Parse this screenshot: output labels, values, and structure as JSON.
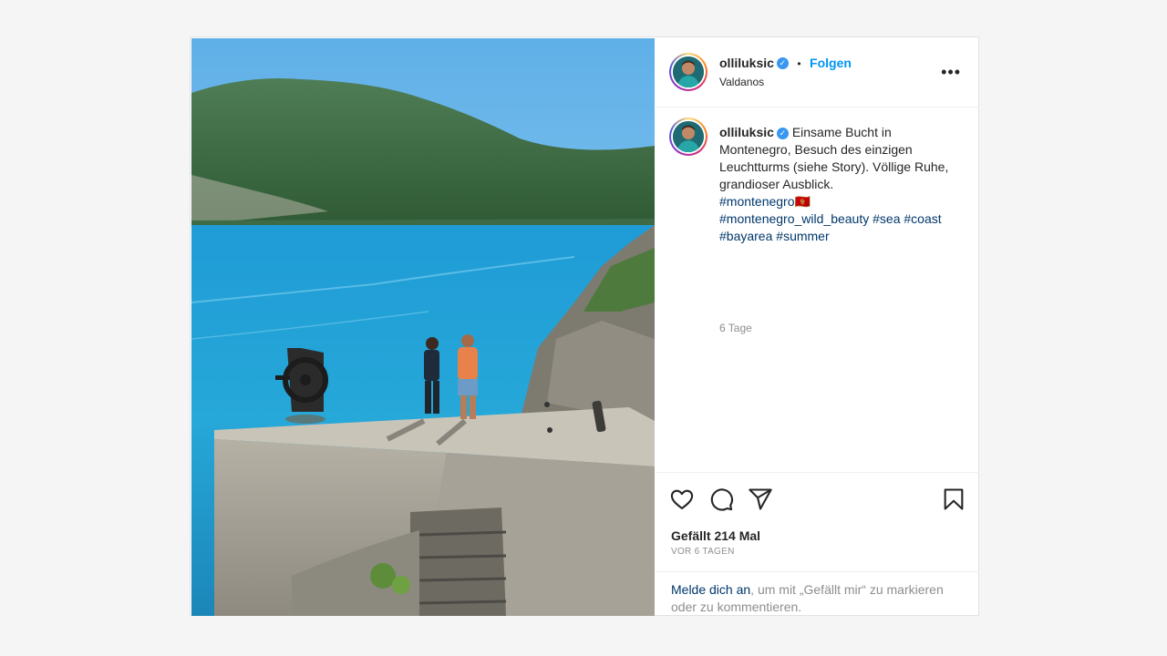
{
  "post": {
    "username": "olliluksic",
    "verified_badge": "verified-check-icon",
    "separator": "•",
    "follow_label": "Folgen",
    "location": "Valdanos",
    "caption_text": "Einsame Bucht in Montenegro, Besuch des einzigen Leuchtturms (siehe Story). Völlige Ruhe, grandioser Ausblick.",
    "hashtags": [
      "#montenegro",
      "#montenegro_wild_beauty",
      "#sea",
      "#coast",
      "#bayarea",
      "#summer"
    ],
    "flag_emoji": "🇲🇪",
    "caption_age": "6 Tage",
    "likes_label": "Gefällt 214 Mal",
    "posted_ago": "VOR 6 TAGEN",
    "login_link": "Melde dich an",
    "login_rest": ", um mit „Gefällt mir“ zu markieren oder zu kommentieren."
  },
  "icons": {
    "more": "more-options-icon",
    "like": "heart-icon",
    "comment": "comment-icon",
    "share": "share-icon",
    "save": "bookmark-icon"
  },
  "colors": {
    "accent": "#0095f6",
    "hashtag": "#00376b",
    "muted": "#8e8e8e",
    "background": "#f5f5f5"
  }
}
